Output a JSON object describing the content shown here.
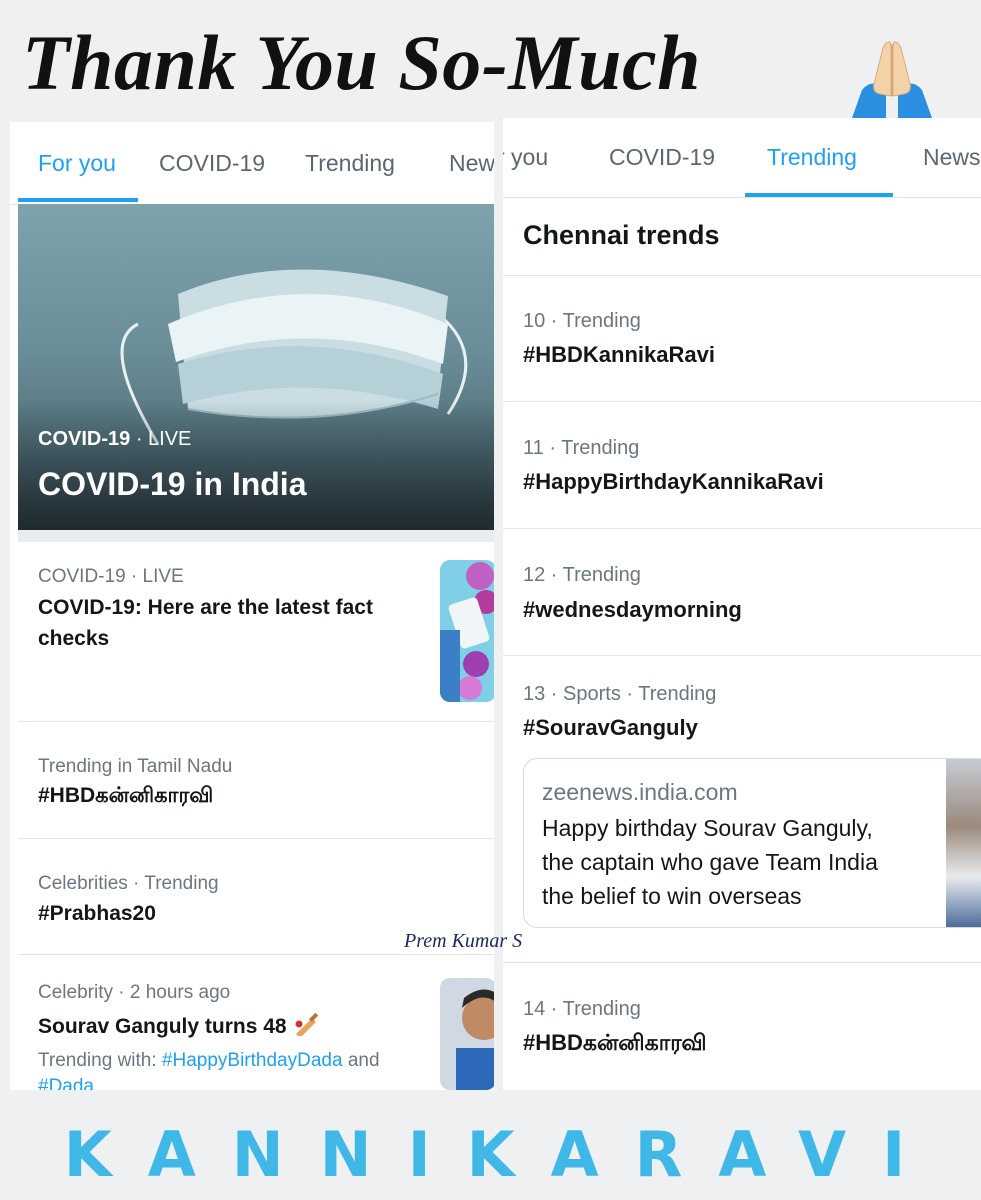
{
  "header": {
    "title": "Thank You So-Much",
    "emoji": "folded-hands"
  },
  "left": {
    "tabs": [
      "For you",
      "COVID-19",
      "Trending",
      "New"
    ],
    "active_tab": "For you",
    "hero": {
      "category": "COVID-19",
      "status": "· LIVE",
      "title": "COVID-19 in India"
    },
    "items": [
      {
        "meta": "COVID-19 · LIVE",
        "title_lines": [
          "COVID-19: Here are the latest fact",
          "checks"
        ]
      },
      {
        "meta": "Trending in Tamil Nadu",
        "title": "#HBDகன்னிகாரவி"
      },
      {
        "meta": "Celebrities · Trending",
        "title": "#Prabhas20"
      },
      {
        "meta": "Celebrity · 2 hours ago",
        "title": "Sourav Ganguly turns 48",
        "trending_with_label": "Trending with:",
        "trending_with_tag": "#HappyBirthdayDada",
        "trending_with_and": "and",
        "trending_with_tag2": "#Dada"
      }
    ]
  },
  "right": {
    "tabs": [
      "r you",
      "COVID-19",
      "Trending",
      "News"
    ],
    "active_tab": "Trending",
    "section_title": "Chennai trends",
    "trends": [
      {
        "meta": "10 · Trending",
        "tag": "#HBDKannikaRavi"
      },
      {
        "meta": "11 · Trending",
        "tag": "#HappyBirthdayKannikaRavi"
      },
      {
        "meta": "12 · Trending",
        "tag": "#wednesdaymorning"
      },
      {
        "meta": "13 · Sports · Trending",
        "tag": "#SouravGanguly"
      },
      {
        "meta": "14 · Trending",
        "tag": "#HBDகன்னிகாரவி"
      }
    ],
    "card": {
      "domain": "zeenews.india.com",
      "lines": [
        "Happy birthday Sourav Ganguly,",
        "the captain who gave Team India",
        "the belief to win overseas"
      ]
    }
  },
  "signature": "Prem Kumar S",
  "footer": {
    "text": "KANNIKARAVI"
  },
  "colors": {
    "accent": "#1da1f2",
    "footer": "#3fb8e8"
  }
}
